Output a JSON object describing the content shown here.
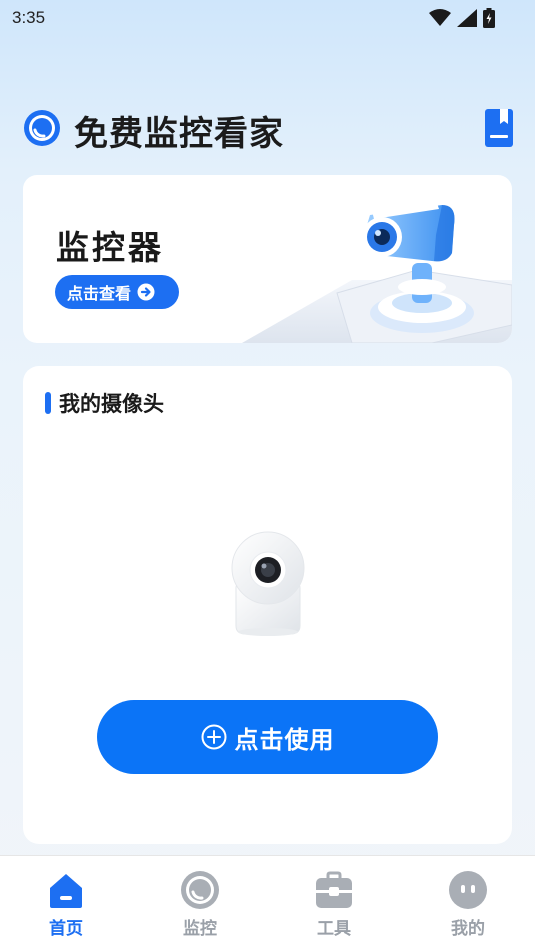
{
  "status_bar": {
    "time": "3:35",
    "icons": [
      "wifi-icon",
      "signal-icon",
      "battery-icon"
    ]
  },
  "header": {
    "title": "免费监控看家",
    "logo_icon": "camera-lens-icon",
    "book_icon": "book-icon"
  },
  "banner": {
    "title": "监控器",
    "button_label": "点击查看"
  },
  "camera_card": {
    "section_title": "我的摄像头",
    "use_button_label": "点击使用"
  },
  "nav": {
    "items": [
      {
        "label": "首页",
        "icon": "home-icon",
        "active": true
      },
      {
        "label": "监控",
        "icon": "monitor-icon",
        "active": false
      },
      {
        "label": "工具",
        "icon": "toolbox-icon",
        "active": false
      },
      {
        "label": "我的",
        "icon": "profile-icon",
        "active": false
      }
    ]
  },
  "colors": {
    "accent": "#1d6ff2",
    "inactive": "#9aa0a8"
  }
}
